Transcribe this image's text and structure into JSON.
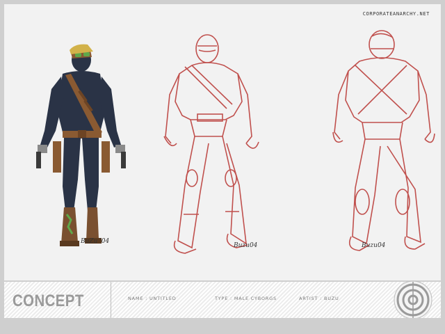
{
  "header": {
    "site_url": "CORPORATEANARCHY.NET"
  },
  "figures": {
    "colored_signature": "BuZu '04",
    "front_signature": "Buzu04",
    "back_signature": "Buzu04"
  },
  "footer": {
    "title": "CONCEPT",
    "name": "NAME : UNTITLED",
    "type": "TYPE : MALE CYBORGS",
    "artist": "ARTIST : BUZU"
  },
  "colors": {
    "background": "#d4d4d4",
    "canvas": "#f2f2f2",
    "sketch_red": "#c0504d",
    "suit_navy": "#2a3346",
    "strap_brown": "#8a5a32",
    "goggle_green": "#5fa84a"
  },
  "icons": {
    "logo": "concentric-target-logo-icon"
  }
}
